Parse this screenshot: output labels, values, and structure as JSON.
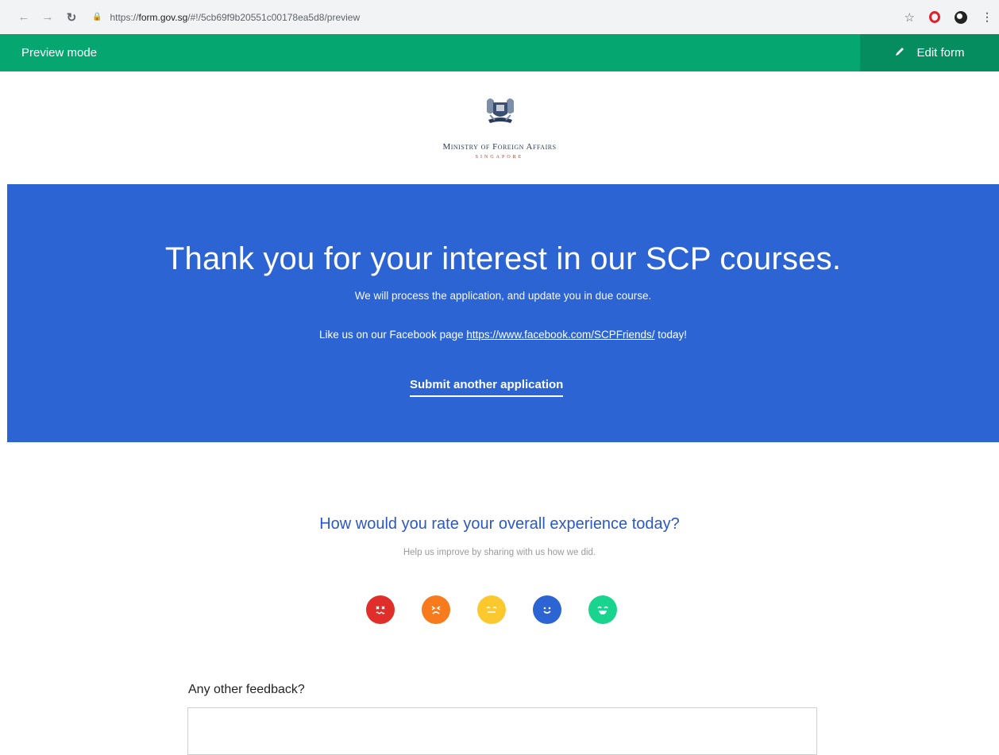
{
  "browser": {
    "url_prefix": "https://",
    "url_host": "form.gov.sg",
    "url_rest": "/#!/5cb69f9b20551c00178ea5d8/preview"
  },
  "preview_bar": {
    "label": "Preview mode",
    "edit_label": "Edit form",
    "bg_color": "#06a670"
  },
  "logo": {
    "ministry": "Ministry of Foreign Affairs",
    "country": "SINGAPORE"
  },
  "hero": {
    "title": "Thank you for your interest in our SCP courses.",
    "subtitle": "We will process the application, and update you in due course.",
    "facebook_prefix": "Like us on our Facebook page ",
    "facebook_link": "https://www.facebook.com/SCPFriends/",
    "facebook_suffix": " today!",
    "submit_another": "Submit another application",
    "bg_color": "#2c64d4"
  },
  "rating": {
    "title": "How would you rate your overall experience today?",
    "subtitle": "Help us improve by sharing with us how we did.",
    "faces": [
      {
        "name": "very-dissatisfied-face-icon",
        "color": "#e02f2a"
      },
      {
        "name": "dissatisfied-face-icon",
        "color": "#f77a1c"
      },
      {
        "name": "neutral-face-icon",
        "color": "#fbc82d"
      },
      {
        "name": "satisfied-face-icon",
        "color": "#2c64d4"
      },
      {
        "name": "very-satisfied-face-icon",
        "color": "#19d48e"
      }
    ]
  },
  "feedback": {
    "label": "Any other feedback?"
  }
}
